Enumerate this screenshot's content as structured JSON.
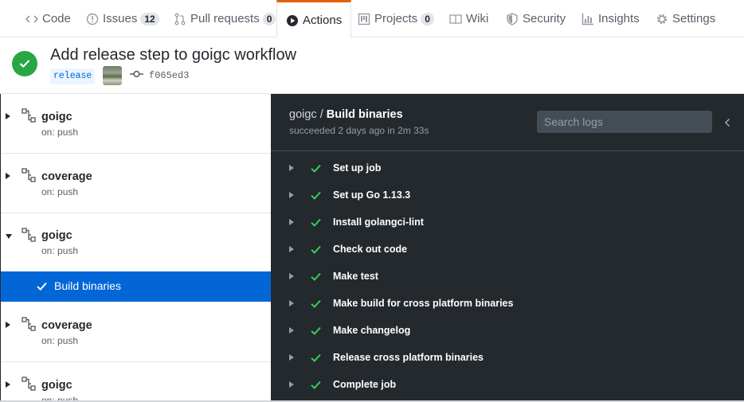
{
  "nav": {
    "tabs": [
      {
        "label": "Code",
        "icon": "code-icon"
      },
      {
        "label": "Issues",
        "count": "12",
        "icon": "issue-icon"
      },
      {
        "label": "Pull requests",
        "count": "0",
        "icon": "pull-request-icon"
      },
      {
        "label": "Actions",
        "icon": "play-icon",
        "selected": true
      },
      {
        "label": "Projects",
        "count": "0",
        "icon": "project-icon"
      },
      {
        "label": "Wiki",
        "icon": "book-icon"
      },
      {
        "label": "Security",
        "icon": "shield-icon"
      },
      {
        "label": "Insights",
        "icon": "graph-icon"
      },
      {
        "label": "Settings",
        "icon": "gear-icon"
      }
    ]
  },
  "run": {
    "title": "Add release step to goigc workflow",
    "branch": "release",
    "commit": "f065ed3",
    "status_color": "#28a745"
  },
  "sidebar": {
    "workflows": [
      {
        "name": "goigc",
        "trigger": "on: push",
        "expanded": false
      },
      {
        "name": "coverage",
        "trigger": "on: push",
        "expanded": false
      },
      {
        "name": "goigc",
        "trigger": "on: push",
        "expanded": true
      },
      {
        "name": "coverage",
        "trigger": "on: push",
        "expanded": false
      },
      {
        "name": "goigc",
        "trigger": "on: push",
        "expanded": false
      }
    ],
    "selected_job": "Build binaries",
    "selected_color": "#0366d6"
  },
  "log": {
    "workflow": "goigc",
    "separator": " / ",
    "job": "Build binaries",
    "status": "succeeded 2 days ago in 2m 33s",
    "search_placeholder": "Search logs",
    "steps": [
      "Set up job",
      "Set up Go 1.13.3",
      "Install golangci-lint",
      "Check out code",
      "Make test",
      "Make build for cross platform binaries",
      "Make changelog",
      "Release cross platform binaries",
      "Complete job"
    ]
  }
}
